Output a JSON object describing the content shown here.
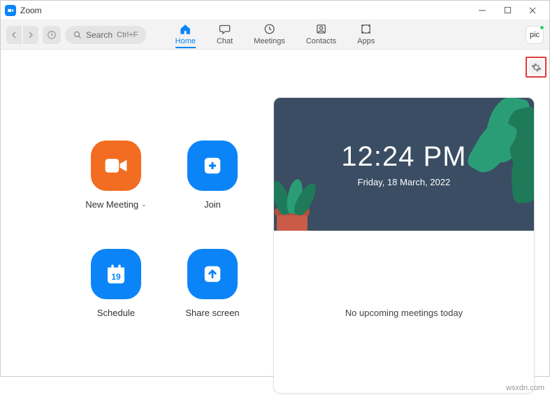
{
  "window": {
    "title": "Zoom"
  },
  "toolbar": {
    "search_label": "Search",
    "search_shortcut": "Ctrl+F"
  },
  "tabs": {
    "home": "Home",
    "chat": "Chat",
    "meetings": "Meetings",
    "contacts": "Contacts",
    "apps": "Apps"
  },
  "avatar": {
    "text": "pic"
  },
  "actions": {
    "new_meeting": "New Meeting",
    "join": "Join",
    "schedule": "Schedule",
    "schedule_day": "19",
    "share_screen": "Share screen"
  },
  "panel": {
    "time": "12:24 PM",
    "date": "Friday, 18 March, 2022",
    "empty": "No upcoming meetings today"
  },
  "watermark": "wsxdn.com"
}
